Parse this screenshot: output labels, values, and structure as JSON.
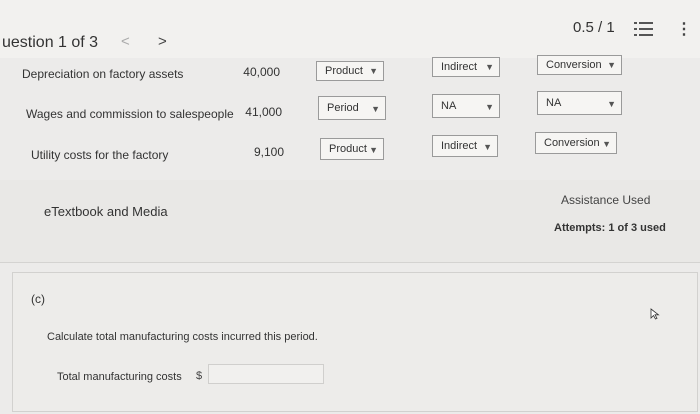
{
  "header": {
    "question_label": "uestion 1 of 3",
    "prev_glyph": "<",
    "next_glyph": ">",
    "score": "0.5 / 1",
    "more_glyph": "⋮"
  },
  "rows": [
    {
      "label": "Depreciation on factory assets",
      "amount": "40,000",
      "cost_type": "Product",
      "direct_indirect": "Indirect",
      "prime_conversion": "Conversion"
    },
    {
      "label": "Wages and commission to salespeople",
      "amount": "41,000",
      "cost_type": "Period",
      "direct_indirect": "NA",
      "prime_conversion": "NA"
    },
    {
      "label": "Utility costs for the factory",
      "amount": "9,100",
      "cost_type": "Product",
      "direct_indirect": "Indirect",
      "prime_conversion": "Conversion"
    }
  ],
  "resources": {
    "etextbook": "eTextbook and Media",
    "assistance": "Assistance Used",
    "attempts": "Attempts: 1 of 3 used"
  },
  "part_c": {
    "label": "(c)",
    "instructions": "Calculate total manufacturing costs incurred this period.",
    "field_label": "Total manufacturing costs",
    "currency": "$",
    "value": ""
  },
  "icons": {
    "chevron": "chevron-down-icon",
    "list": "list-icon",
    "more": "more-vertical-icon",
    "cursor": "mouse-cursor-icon"
  }
}
